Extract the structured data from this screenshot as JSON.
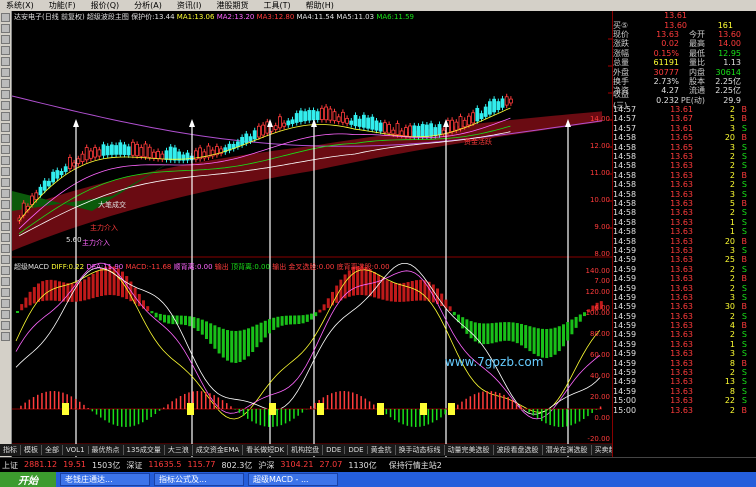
{
  "menu": [
    "系统(X)",
    "功能(F)",
    "报价(Q)",
    "分析(A)",
    "资讯(I)",
    "港股期货",
    "工具(T)",
    "帮助(H)"
  ],
  "chart_header": {
    "title": "达安电子(日线 前复权) 超级波段主图",
    "ma_labels": [
      {
        "t": "保护价:13.44",
        "c": "#e0e0e0"
      },
      {
        "t": "MA1:13.06",
        "c": "#ffff33"
      },
      {
        "t": "MA2:13.20",
        "c": "#ff66ff"
      },
      {
        "t": "MA3:12.80",
        "c": "#ff3b3b"
      },
      {
        "t": "MA4:11.54",
        "c": "#e0e0e0"
      },
      {
        "t": "MA5:11.03",
        "c": "#e0e0e0"
      },
      {
        "t": "MA6:11.59",
        "c": "#19e019"
      }
    ]
  },
  "annotations": {
    "main_force_in": "主力介入",
    "main_force_in2": "主力介入",
    "big_volume": "大笔成交",
    "low_price": "5.60",
    "capital_active": "资金活跃"
  },
  "price_axis": [
    "14.00",
    "12.00",
    "11.00",
    "10.00",
    "9.00",
    "8.00",
    "7.00",
    "6.00"
  ],
  "macd_header": {
    "title": "超级MACD",
    "items": [
      {
        "t": "DIFF:0.22",
        "c": "#ffff33"
      },
      {
        "t": "DEA:11.90",
        "c": "#ff66ff"
      },
      {
        "t": "MACD:-11.68",
        "c": "#ff3b3b"
      },
      {
        "t": "顺背离:0.00",
        "c": "#ff66ff"
      },
      {
        "t": "输出",
        "c": "#ff3b3b"
      },
      {
        "t": "顶背离:0.00",
        "c": "#19e019"
      },
      {
        "t": "输出",
        "c": "#ff3b3b"
      },
      {
        "t": "金叉选股:0.00",
        "c": "#ff3b3b"
      },
      {
        "t": "底背离选股:0.00",
        "c": "#ff3b3b"
      }
    ]
  },
  "macd_axis": [
    "140.00",
    "120.00",
    "100.00",
    "80.00",
    "60.00",
    "40.00",
    "20.00",
    "0.00",
    "-20.00"
  ],
  "macd_marker": "81.90",
  "date_axis": {
    "left": "2009年",
    "cursor": "2009/04/15/三",
    "ticks": [
      "1",
      "2",
      "3",
      "4",
      "5",
      "6",
      "7",
      "8",
      "9"
    ]
  },
  "tabs": [
    "指标",
    "模板",
    "全部",
    "VOL1",
    "最优热点",
    "135成交量",
    "大三浪",
    "成交资金EMA",
    "看长做短DK",
    "机构控盘",
    "DDE",
    "DDE",
    "黄金抗",
    "换手动态标线",
    "动量完美选股",
    "波段看盘选股",
    "潜龙在渊选股",
    "买卖趋势选股",
    "绝对底"
  ],
  "quote": {
    "top": [
      {
        "l": "",
        "v1": "13.61",
        "v2": ""
      },
      {
        "l": "买⑤",
        "v1": "13.60",
        "v2": "161"
      }
    ],
    "rows": [
      {
        "l": "现价",
        "v": "13.63",
        "c": "r",
        "l2": "今开",
        "v2": "13.60",
        "c2": "r"
      },
      {
        "l": "涨跌",
        "v": "0.02",
        "c": "r",
        "l2": "最高",
        "v2": "14.00",
        "c2": "r"
      },
      {
        "l": "涨幅",
        "v": "0.15%",
        "c": "r",
        "l2": "最低",
        "v2": "12.95",
        "c2": "g"
      },
      {
        "l": "总量",
        "v": "61191",
        "c": "y",
        "l2": "量比",
        "v2": "1.13",
        "c2": "w"
      },
      {
        "l": "外盘",
        "v": "30777",
        "c": "r",
        "l2": "内盘",
        "v2": "30614",
        "c2": "g"
      },
      {
        "l": "换手",
        "v": "2.73%",
        "c": "w",
        "l2": "股本",
        "v2": "2.25亿",
        "c2": "w"
      },
      {
        "l": "净资",
        "v": "4.27",
        "c": "w",
        "l2": "流通",
        "v2": "2.25亿",
        "c2": "w"
      },
      {
        "l": "收益(三)",
        "v": "0.232",
        "c": "w",
        "l2": "PE(动)",
        "v2": "29.9",
        "c2": "w"
      }
    ],
    "ticks": [
      {
        "t": "14:57",
        "p": "13.61",
        "v": "2",
        "s": "B"
      },
      {
        "t": "14:57",
        "p": "13.67",
        "v": "5",
        "s": "B"
      },
      {
        "t": "14:57",
        "p": "13.61",
        "v": "3",
        "s": "S"
      },
      {
        "t": "14:58",
        "p": "13.65",
        "v": "20",
        "s": "B"
      },
      {
        "t": "14:58",
        "p": "13.65",
        "v": "3",
        "s": "S"
      },
      {
        "t": "14:58",
        "p": "13.63",
        "v": "2",
        "s": "S"
      },
      {
        "t": "14:58",
        "p": "13.63",
        "v": "2",
        "s": "S"
      },
      {
        "t": "14:58",
        "p": "13.63",
        "v": "2",
        "s": "B"
      },
      {
        "t": "14:58",
        "p": "13.63",
        "v": "2",
        "s": "S"
      },
      {
        "t": "14:58",
        "p": "13.63",
        "v": "3",
        "s": "S"
      },
      {
        "t": "14:58",
        "p": "13.63",
        "v": "5",
        "s": "B"
      },
      {
        "t": "14:58",
        "p": "13.63",
        "v": "2",
        "s": "S"
      },
      {
        "t": "14:58",
        "p": "13.63",
        "v": "1",
        "s": "S"
      },
      {
        "t": "14:58",
        "p": "13.63",
        "v": "1",
        "s": "S"
      },
      {
        "t": "14:58",
        "p": "13.63",
        "v": "20",
        "s": "B"
      },
      {
        "t": "14:59",
        "p": "13.63",
        "v": "3",
        "s": "S"
      },
      {
        "t": "14:59",
        "p": "13.63",
        "v": "25",
        "s": "B"
      },
      {
        "t": "14:59",
        "p": "13.63",
        "v": "2",
        "s": "S"
      },
      {
        "t": "14:59",
        "p": "13.63",
        "v": "2",
        "s": "B"
      },
      {
        "t": "14:59",
        "p": "13.63",
        "v": "2",
        "s": "S"
      },
      {
        "t": "14:59",
        "p": "13.63",
        "v": "3",
        "s": "S"
      },
      {
        "t": "14:59",
        "p": "13.63",
        "v": "30",
        "s": "B"
      },
      {
        "t": "14:59",
        "p": "13.63",
        "v": "2",
        "s": "S"
      },
      {
        "t": "14:59",
        "p": "13.63",
        "v": "4",
        "s": "B"
      },
      {
        "t": "14:59",
        "p": "13.63",
        "v": "2",
        "s": "S"
      },
      {
        "t": "14:59",
        "p": "13.63",
        "v": "1",
        "s": "S"
      },
      {
        "t": "14:59",
        "p": "13.63",
        "v": "3",
        "s": "S"
      },
      {
        "t": "14:59",
        "p": "13.63",
        "v": "8",
        "s": "B"
      },
      {
        "t": "14:59",
        "p": "13.63",
        "v": "2",
        "s": "S"
      },
      {
        "t": "14:59",
        "p": "13.63",
        "v": "13",
        "s": "S"
      },
      {
        "t": "14:59",
        "p": "13.63",
        "v": "8",
        "s": "S"
      },
      {
        "t": "15:00",
        "p": "13.63",
        "v": "22",
        "s": "S"
      },
      {
        "t": "15:00",
        "p": "13.63",
        "v": "2",
        "s": "B"
      }
    ]
  },
  "index_bar": [
    {
      "l": "上证",
      "c": "w"
    },
    {
      "l": "2881.12",
      "c": "r"
    },
    {
      "l": "19.51",
      "c": "r"
    },
    {
      "l": "1503亿",
      "c": "w"
    },
    {
      "l": "深证",
      "c": "w"
    },
    {
      "l": "11635.5",
      "c": "r"
    },
    {
      "l": "115.77",
      "c": "r"
    },
    {
      "l": "802.3亿",
      "c": "w"
    },
    {
      "l": "沪深",
      "c": "w"
    },
    {
      "l": "3104.21",
      "c": "r"
    },
    {
      "l": "27.07",
      "c": "r"
    },
    {
      "l": "1130亿",
      "c": "w"
    }
  ],
  "index_extra": "保持行情主站2",
  "watermark": "www.7gpzb.com",
  "taskbar": {
    "start": "开始",
    "tasks": [
      "老钱庄通达...",
      "指标公式及...",
      "超级MACD - ..."
    ]
  }
}
